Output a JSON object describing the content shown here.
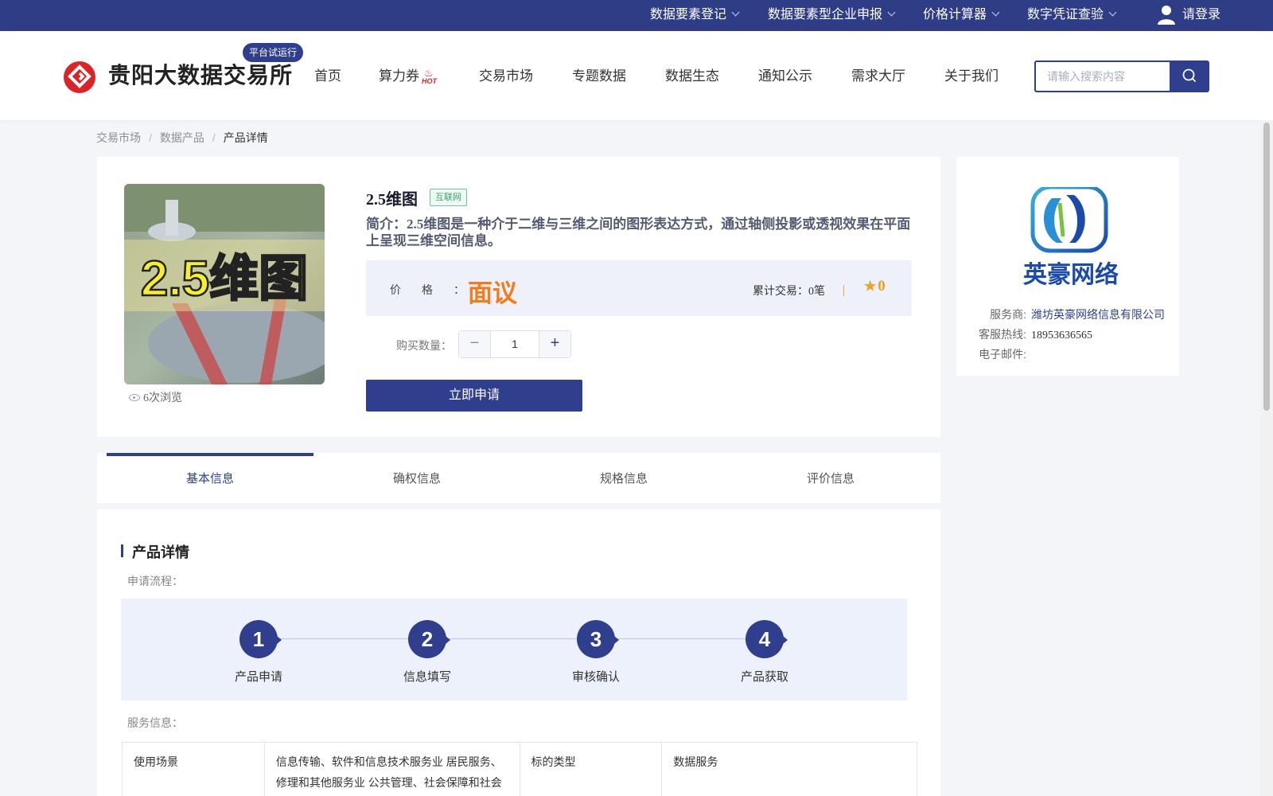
{
  "topbar": {
    "items": [
      {
        "label": "数据要素登记"
      },
      {
        "label": "数据要素型企业申报"
      },
      {
        "label": "价格计算器"
      },
      {
        "label": "数字凭证查验"
      }
    ],
    "login_label": "请登录",
    "color": "#2e3d86"
  },
  "header": {
    "logo_text": "贵阳大数据交易所",
    "trial_badge": "平台试运行",
    "nav": [
      "首页",
      "算力券",
      "交易市场",
      "专题数据",
      "数据生态",
      "通知公示",
      "需求大厅",
      "关于我们"
    ],
    "hot_badge": "HOT",
    "search_placeholder": "请输入搜索内容"
  },
  "breadcrumb": {
    "items": [
      "交易市场",
      "数据产品",
      "产品详情"
    ]
  },
  "product": {
    "image_text": "2.5维图",
    "views": "6次浏览",
    "title": "2.5维图",
    "tag": "互联网",
    "description": "简介：2.5维图是一种介于二维与三维之间的图形表达方式，通过轴侧投影或透视效果在平面上呈现三维空间信息。",
    "price_label": "价格：",
    "price_value": "面议",
    "trades_label": "累计交易：",
    "trades_value": "0笔",
    "rating": "0",
    "qty_label": "购买数量：",
    "qty_value": "1",
    "apply_label": "立即申请",
    "accent_color": "#f07c1c"
  },
  "provider": {
    "logo_text": "英豪网络",
    "rows": [
      {
        "key": "服务商:",
        "value": "潍坊英豪网络信息有限公司"
      },
      {
        "key": "客服热线:",
        "value": "18953636565"
      },
      {
        "key": "电子邮件:",
        "value": ""
      }
    ]
  },
  "tabs": [
    "基本信息",
    "确权信息",
    "规格信息",
    "评价信息"
  ],
  "detail": {
    "section_title": "产品详情",
    "flow_label": "申请流程：",
    "steps": [
      {
        "num": "1",
        "label": "产品申请"
      },
      {
        "num": "2",
        "label": "信息填写"
      },
      {
        "num": "3",
        "label": "审核确认"
      },
      {
        "num": "4",
        "label": "产品获取"
      }
    ],
    "service_label": "服务信息：",
    "table": [
      {
        "k1": "使用场景",
        "v1": "信息传输、软件和信息技术服务业 居民服务、修理和其他服务业 公共管理、社会保障和社会",
        "k2": "标的类型",
        "v2": "数据服务"
      }
    ]
  }
}
